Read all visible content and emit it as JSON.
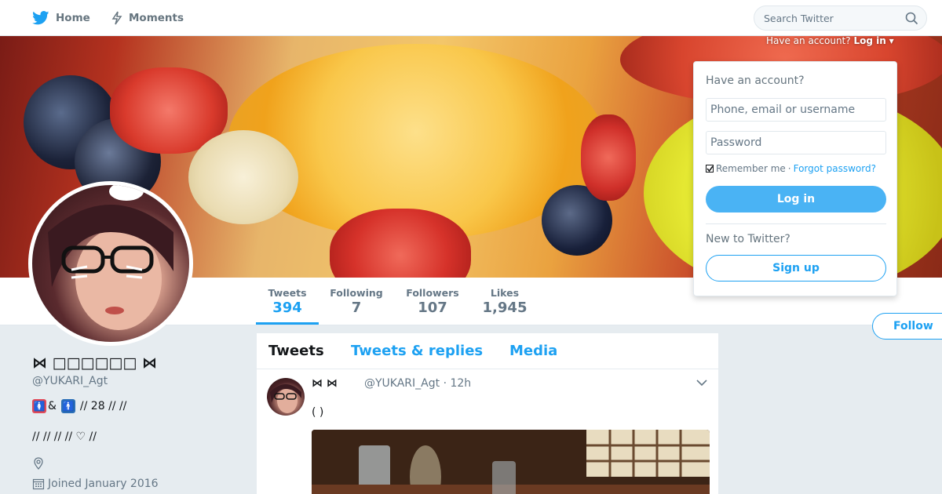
{
  "nav": {
    "home_label": "Home",
    "moments_label": "Moments",
    "search_placeholder": "Search Twitter"
  },
  "login_toggle": {
    "prefix": "Have an account?",
    "action": "Log in"
  },
  "login_panel": {
    "heading": "Have an account?",
    "username_placeholder": "Phone, email or username",
    "password_placeholder": "Password",
    "remember_label": "Remember me",
    "separator": "·",
    "forgot_label": "Forgot password?",
    "login_button": "Log in",
    "new_to_label": "New to Twitter?",
    "signup_button": "Sign up"
  },
  "stats": [
    {
      "label": "Tweets",
      "value": "394"
    },
    {
      "label": "Following",
      "value": "7"
    },
    {
      "label": "Followers",
      "value": "107"
    },
    {
      "label": "Likes",
      "value": "1,945"
    }
  ],
  "follow_button": "Follow",
  "profile": {
    "name": "⋈ □□□□□□ ⋈",
    "handle": "@YUKARI_Agt",
    "bio_line1_amp": "&",
    "bio_line1_rest": "// 28 //  //",
    "bio_line2": "//  //  //  // ♡ //",
    "joined": "Joined January 2016"
  },
  "timeline": {
    "tabs": [
      "Tweets",
      "Tweets & replies",
      "Media"
    ],
    "tweet": {
      "name": "⋈  ⋈",
      "handle_time": "@YUKARI_Agt · 12h",
      "text": "(  )"
    }
  },
  "colors": {
    "accent": "#1da1f2",
    "background": "#e6ecf0"
  }
}
